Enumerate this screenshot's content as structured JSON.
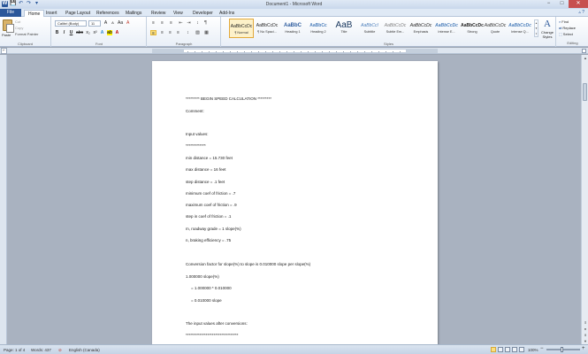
{
  "window": {
    "title": "Document1 - Microsoft Word",
    "minimize": "−",
    "maximize": "□",
    "close": "✕"
  },
  "quick_access": [
    "W",
    "💾",
    "↶",
    "↷",
    "▾"
  ],
  "tabs": [
    {
      "label": "File"
    },
    {
      "label": "Home"
    },
    {
      "label": "Insert"
    },
    {
      "label": "Page Layout"
    },
    {
      "label": "References"
    },
    {
      "label": "Mailings"
    },
    {
      "label": "Review"
    },
    {
      "label": "View"
    },
    {
      "label": "Developer"
    },
    {
      "label": "Add-Ins"
    }
  ],
  "help_icons": "▵ ?",
  "clipboard": {
    "group": "Clipboard",
    "paste": "Paste",
    "cut": "Cut",
    "copy": "Copy",
    "format_painter": "Format Painter"
  },
  "font": {
    "group": "Font",
    "name": "Calibri (Body)",
    "size": "11",
    "grow": "A",
    "shrink": "A",
    "case": "Aa",
    "clear": "A",
    "bold": "B",
    "italic": "I",
    "underline": "U",
    "strike": "abc",
    "subscript": "x₂",
    "superscript": "x²",
    "effects": "A",
    "highlight": "ab",
    "color": "A"
  },
  "paragraph": {
    "group": "Paragraph",
    "bullets": "≡",
    "numbering": "≡",
    "multilevel": "≡",
    "decrease_indent": "⇤",
    "increase_indent": "⇥",
    "sort": "↕",
    "show_marks": "¶",
    "align_left": "≡",
    "center": "≡",
    "align_right": "≡",
    "justify": "≡",
    "line_spacing": "↕",
    "shading": "▨",
    "borders": "▦"
  },
  "styles": {
    "group": "Styles",
    "items": [
      {
        "preview": "AaBbCcDc",
        "name": "¶ Normal"
      },
      {
        "preview": "AaBbCcDc",
        "name": "¶ No Spaci..."
      },
      {
        "preview": "AaBbC",
        "name": "Heading 1"
      },
      {
        "preview": "AaBbCc",
        "name": "Heading 2"
      },
      {
        "preview": "AaB",
        "name": "Title"
      },
      {
        "preview": "AaBbCcI",
        "name": "Subtitle"
      },
      {
        "preview": "AaBbCcDc",
        "name": "Subtle Em..."
      },
      {
        "preview": "AaBbCcDc",
        "name": "Emphasis"
      },
      {
        "preview": "AaBbCcDc",
        "name": "Intense E..."
      },
      {
        "preview": "AaBbCcDc",
        "name": "Strong"
      },
      {
        "preview": "AaBbCcDc",
        "name": "Quote"
      },
      {
        "preview": "AaBbCcDc",
        "name": "Intense Q..."
      }
    ],
    "change_styles": "Change Styles"
  },
  "editing": {
    "group": "Editing",
    "find": "Find",
    "replace": "Replace",
    "select": "Select"
  },
  "document": {
    "lines": [
      "********* BEGIN SPEED CALCULATION *********",
      "Comment:",
      "Input values:",
      "*************",
      "min distance = 15.730  feet",
      "max distance = 16  feet",
      "step distance = .1 feet",
      "minimum coef of friction = .7",
      "maximum coef of friction = .9",
      "step in coef of friction = .1",
      "m, roadway grade = 1 slope(%)",
      "n, braking efficiency = .75",
      "Conversion factor for slope(%) to slope is 0.010000  slope per slope(%)",
      "1.000000  slope(%)",
      "= 1.000000  * 0.010000",
      "= 0.010000  slope",
      "The input values after conversions:",
      "**********************************"
    ]
  },
  "status": {
    "page": "Page: 1 of 4",
    "words": "Words: 437",
    "language": "English (Canada)",
    "zoom": "100%",
    "zoom_out": "−",
    "zoom_in": "+"
  }
}
